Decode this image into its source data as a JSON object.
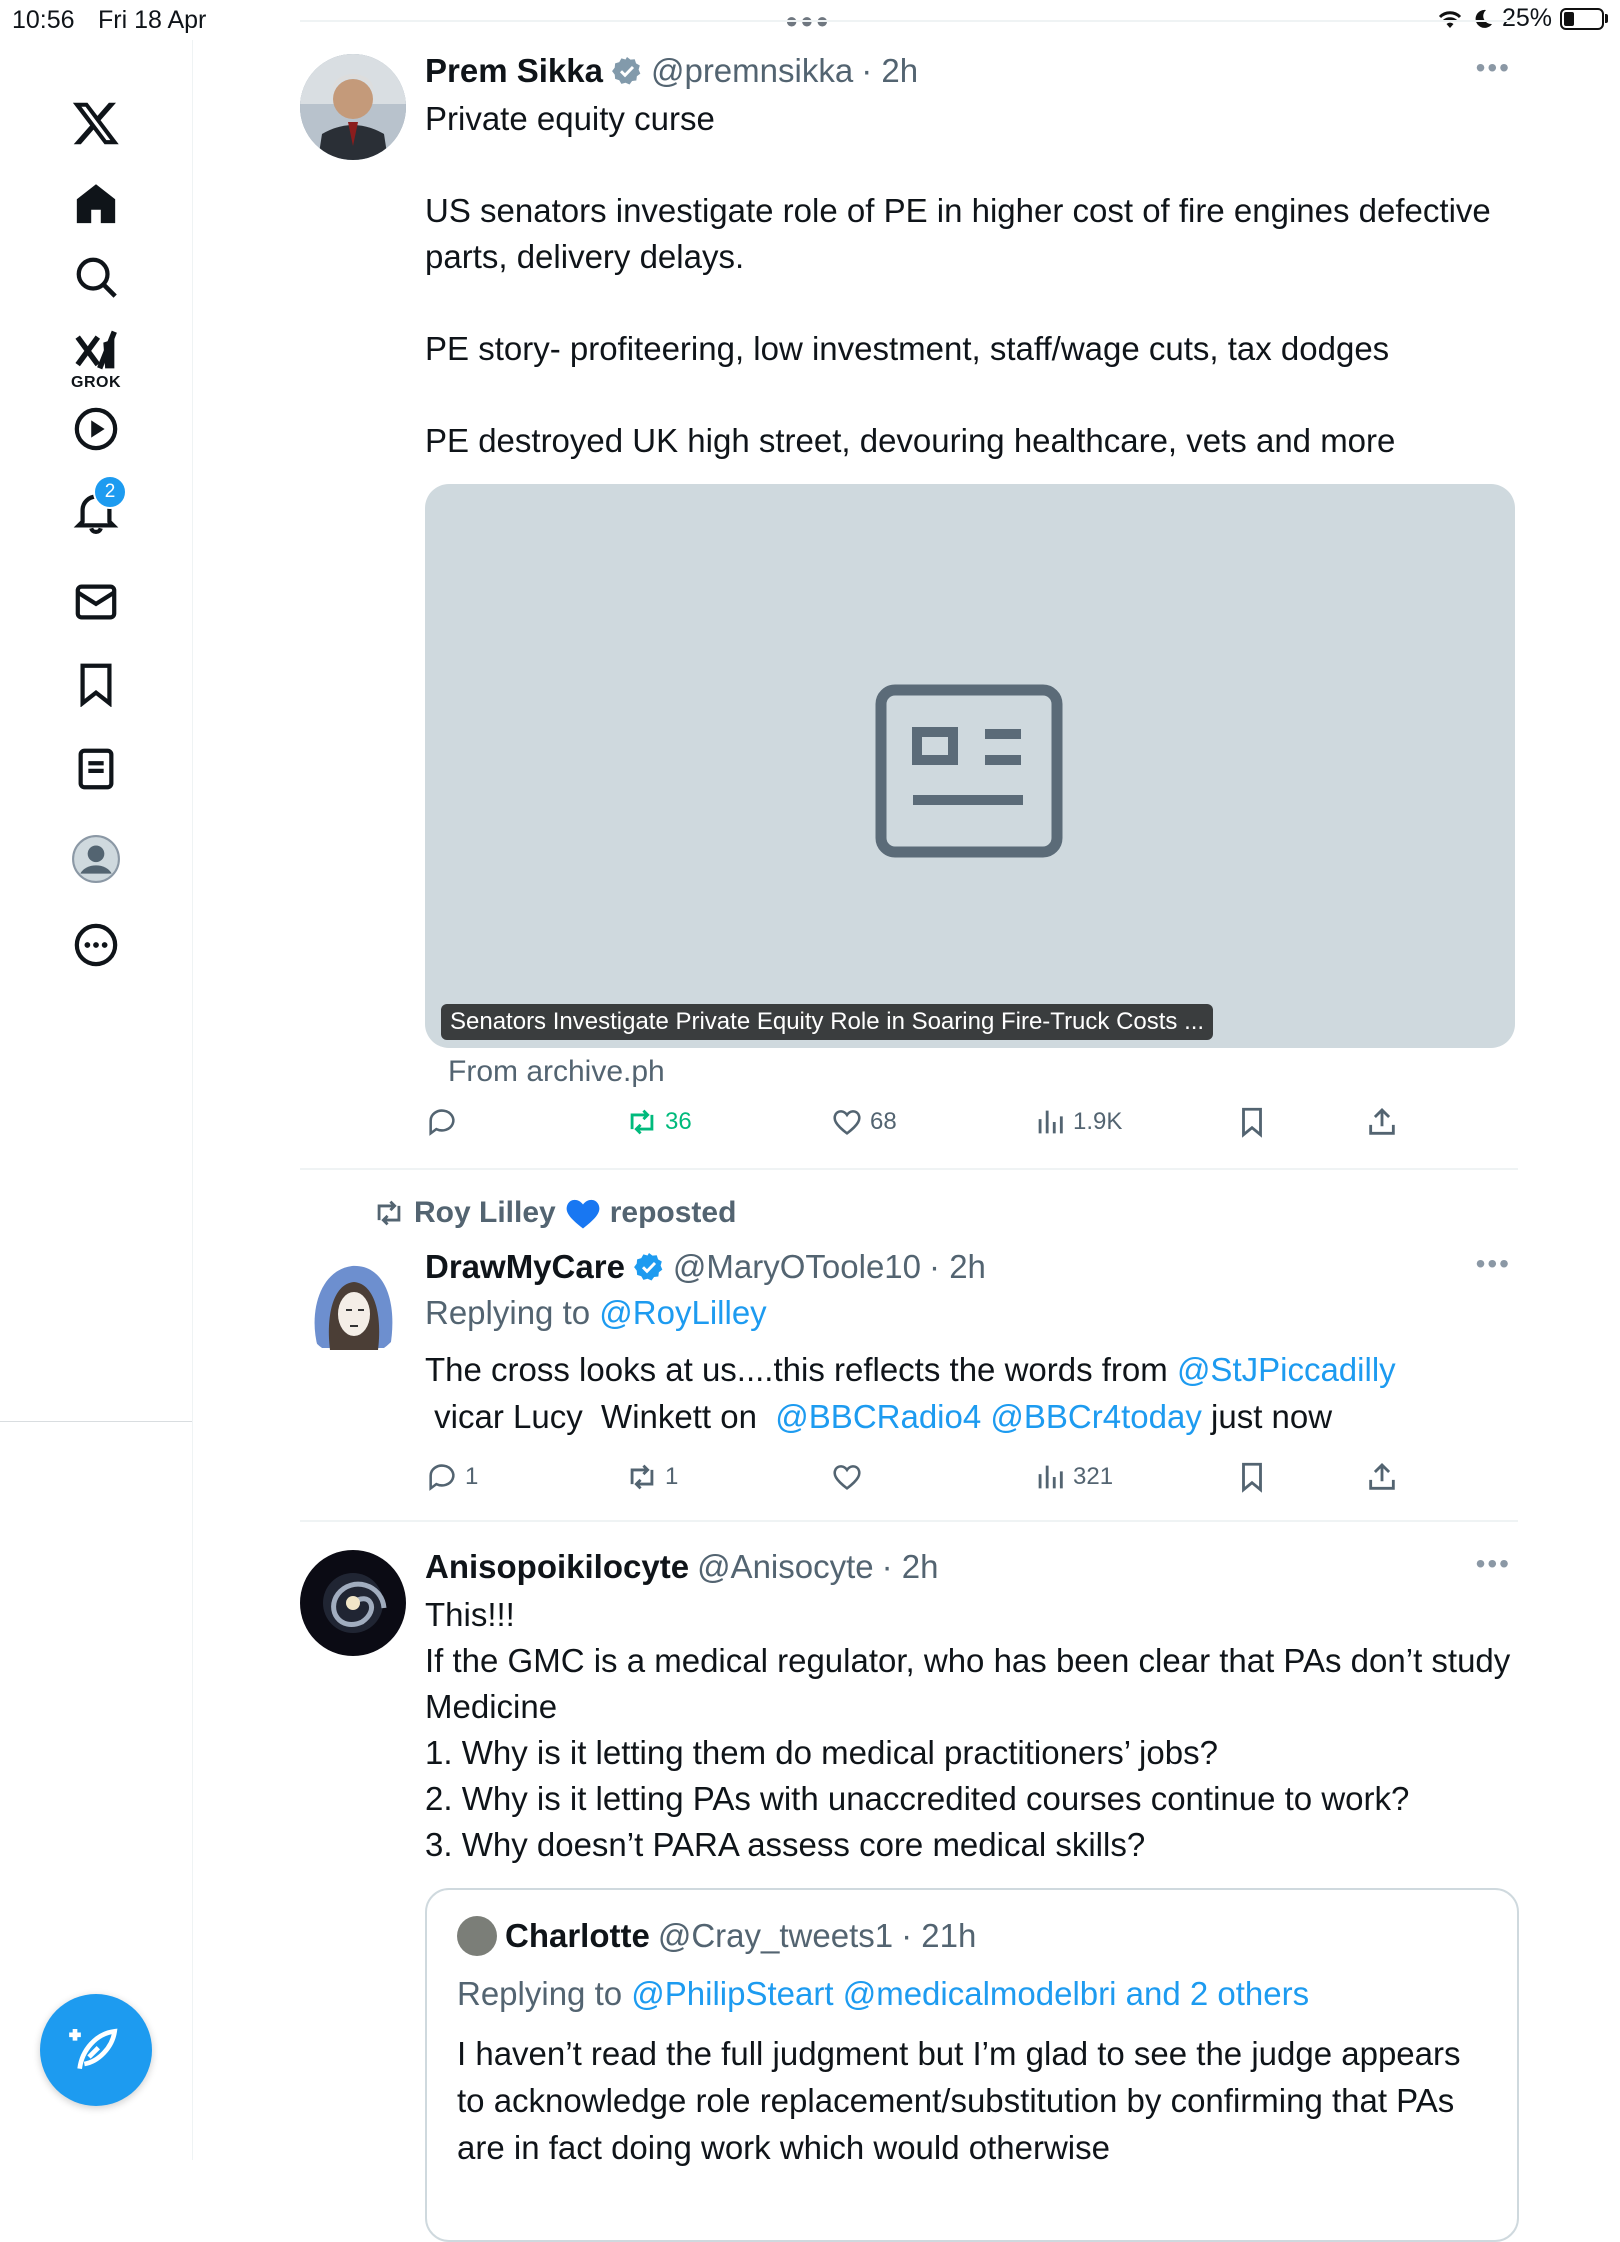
{
  "status_bar": {
    "time": "10:56",
    "date": "Fri 18 Apr",
    "battery_percent": "25%",
    "battery_level": 0.25
  },
  "sidebar": {
    "logo": "x-logo-icon",
    "items": [
      {
        "name": "home",
        "icon": "home-icon"
      },
      {
        "name": "explore",
        "icon": "search-icon"
      },
      {
        "name": "grok",
        "icon": "grok-icon",
        "label": "GROK"
      },
      {
        "name": "videos",
        "icon": "play-icon"
      },
      {
        "name": "notifications",
        "icon": "bell-icon",
        "badge": "2"
      },
      {
        "name": "messages",
        "icon": "mail-icon"
      },
      {
        "name": "bookmarks",
        "icon": "bookmark-icon"
      },
      {
        "name": "lists",
        "icon": "list-icon"
      },
      {
        "name": "profile",
        "icon": "profile-icon"
      },
      {
        "name": "more",
        "icon": "more-circle-icon"
      }
    ],
    "compose": "compose-icon"
  },
  "tweets": [
    {
      "name": "Prem Sikka",
      "handle": "@premnsikka",
      "time": "· 2h",
      "text": "Private equity curse\n\nUS senators investigate role of PE in higher cost of fire engines defective parts, delivery delays.\n\nPE story- profiteering, low investment, staff/wage cuts, tax dodges\n\nPE destroyed UK high street, devouring healthcare, vets and more",
      "card": {
        "title": "Senators Investigate Private Equity Role in Soaring Fire-Truck Costs ...",
        "from": "From archive.ph"
      },
      "stats": {
        "replies": "",
        "reposts": "36",
        "likes": "68",
        "views": "1.9K"
      }
    },
    {
      "reposted_by": "Roy Lilley",
      "reposted_label": "reposted",
      "name": "DrawMyCare",
      "handle": "@MaryOToole10",
      "time": "· 2h",
      "replying_label": "Replying to",
      "replying_to": "@RoyLilley",
      "text_parts": [
        "The cross looks at us....this reflects the words from ",
        "@StJPiccadilly",
        " vicar Lucy  Winkett on  ",
        "@BBCRadio4",
        " ",
        "@BBCr4today",
        " just now"
      ],
      "stats": {
        "replies": "1",
        "reposts": "1",
        "likes": "",
        "views": "321"
      }
    },
    {
      "name": "Anisopoikilocyte",
      "handle": "@Anisocyte",
      "time": "· 2h",
      "text": "This!!!\nIf the GMC is a medical regulator, who has been clear that PAs don’t study Medicine\n1. Why is it letting them do medical practitioners’ jobs?\n2. Why is it letting PAs with unaccredited courses continue to work?\n3. Why doesn’t PARA assess core medical skills?",
      "quote": {
        "name": "Charlotte",
        "handle": "@Cray_tweets1",
        "time": "· 21h",
        "replying_label": "Replying to",
        "replying_to": "@PhilipSteart @medicalmodelbri and 2 others",
        "text": "I haven’t read the full judgment but I’m glad to see the judge appears to acknowledge role replacement/substitution by confirming that PAs are in fact doing work which would otherwise"
      }
    }
  ],
  "colors": {
    "accent": "#1d9bf0",
    "repost_green": "#00ba7c",
    "muted": "#536471",
    "card_bg": "#cfd9de"
  }
}
